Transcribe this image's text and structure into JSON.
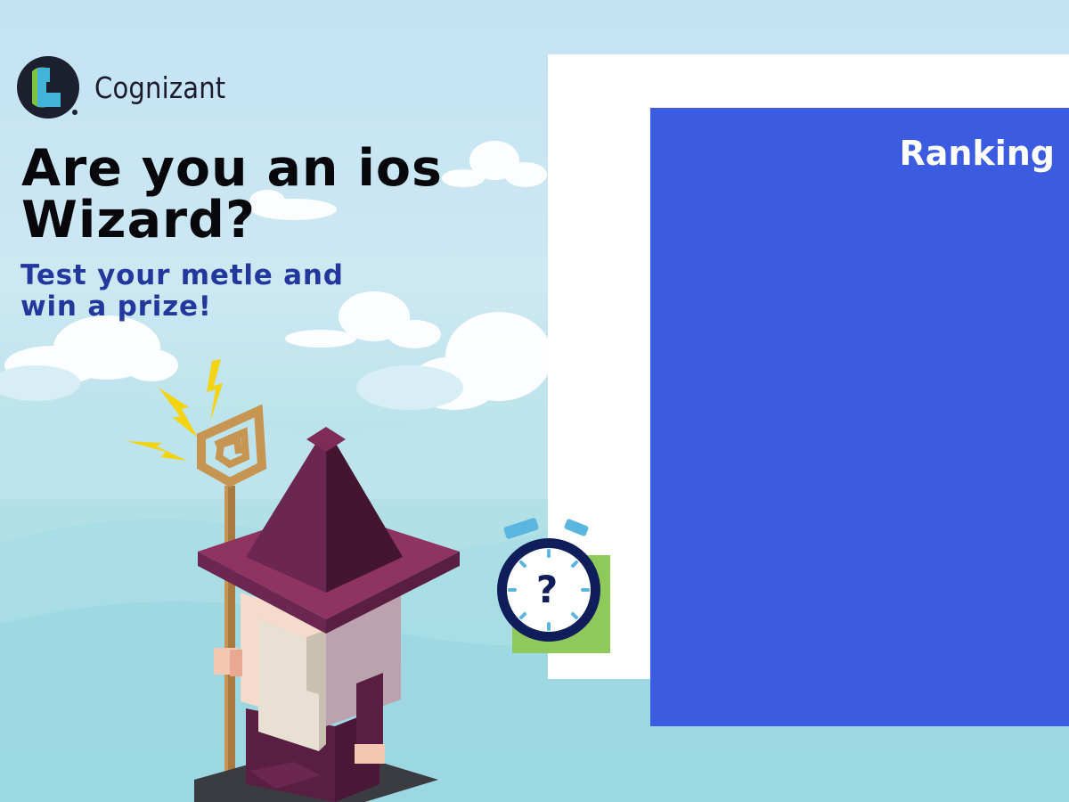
{
  "brand": {
    "name": "Cognizant",
    "logo_icon": "cognizant-logo-icon"
  },
  "hero": {
    "headline_line1": "Are you an ios",
    "headline_line2": "Wizard?",
    "subline_line1": "Test your metle and",
    "subline_line2": "win a prize!"
  },
  "panel": {
    "title": "Ranking"
  },
  "timer": {
    "symbol": "?",
    "icon": "stopwatch-icon"
  },
  "illustration": {
    "icon": "wizard-illustration"
  },
  "colors": {
    "accent_blue": "#3b5be0",
    "headline_text": "#08080c",
    "subline_text": "#22389c",
    "timer_green": "#8fc95c",
    "timer_navy": "#0f1e5a"
  }
}
